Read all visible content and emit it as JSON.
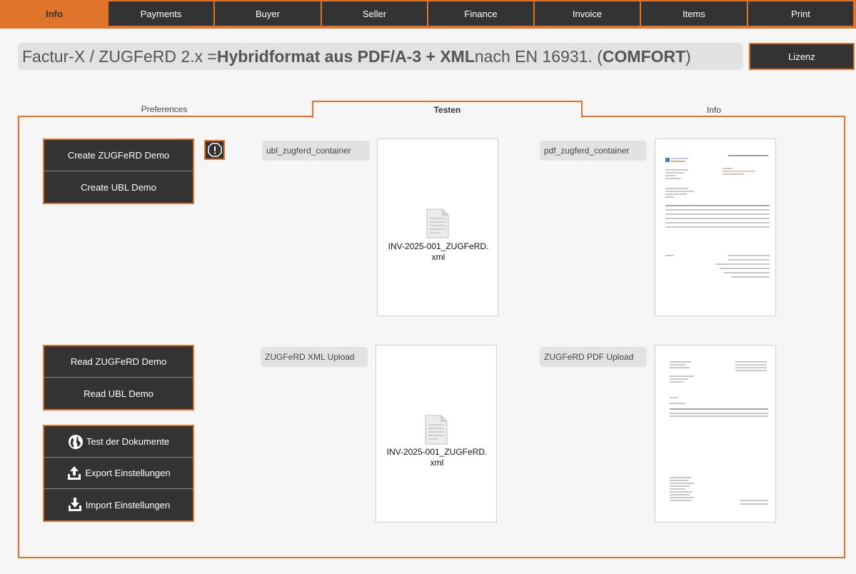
{
  "nav": {
    "tabs": [
      "Info",
      "Payments",
      "Buyer",
      "Seller",
      "Finance",
      "Invoice",
      "Items",
      "Print"
    ],
    "active": "Info"
  },
  "header": {
    "title_prefix": "Factur-X / ZUGFeRD 2.x = ",
    "title_bold": "Hybridformat aus PDF/A-3 + XML",
    "title_middle": " nach EN 16931. (",
    "title_profile": "COMFORT",
    "title_suffix": ")",
    "lizenz_label": "Lizenz"
  },
  "subtabs": {
    "preferences": "Preferences",
    "testen": "Testen",
    "info": "Info"
  },
  "buttons": {
    "create_zugferd": "Create ZUGFeRD Demo",
    "create_ubl": "Create UBL Demo",
    "read_zugferd": "Read ZUGFeRD Demo",
    "read_ubl": "Read UBL Demo",
    "test_docs": "Test der Dokumente",
    "export_settings": "Export Einstellungen",
    "import_settings": "Import Einstellungen"
  },
  "containers": {
    "ubl_label": "ubl_zugferd_container",
    "ubl_file_line1": "INV-2025-001_ZUGFeRD.",
    "ubl_file_line2": "xml",
    "pdf_label": "pdf_zugferd_container",
    "xml_upload_label": "ZUGFeRD XML Upload",
    "xml_upload_file_line1": "INV-2025-001_ZUGFeRD.",
    "xml_upload_file_line2": "xml",
    "pdf_upload_label": "ZUGFeRD PDF Upload"
  },
  "colors": {
    "accent": "#e0732a",
    "dark": "#333333",
    "background": "#f6f6f6"
  }
}
